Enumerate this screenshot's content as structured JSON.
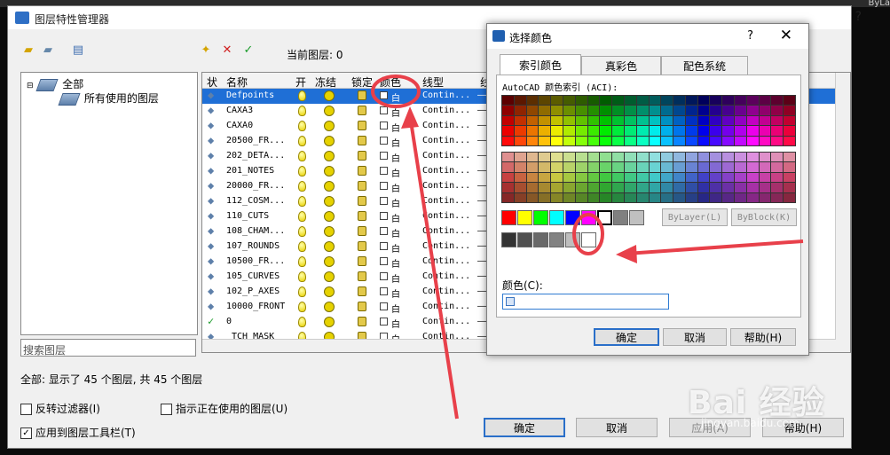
{
  "topbar": {
    "right_text": "ByLa"
  },
  "main_window": {
    "title": "图层特性管理器",
    "help_glyph": "?",
    "current_layer_label": "当前图层: 0",
    "tree": {
      "root": "全部",
      "child": "所有使用的图层"
    },
    "search_placeholder": "搜索图层",
    "columns": [
      "状",
      "名称",
      "开",
      "冻结",
      "锁定",
      "颜色",
      "线型",
      "线"
    ],
    "rows": [
      {
        "name": "Defpoints",
        "color": "白",
        "linetype": "Contin..."
      },
      {
        "name": "CAXA3",
        "color": "白",
        "linetype": "Contin..."
      },
      {
        "name": "CAXA0",
        "color": "白",
        "linetype": "Contin..."
      },
      {
        "name": "20500_FR...",
        "color": "白",
        "linetype": "Contin..."
      },
      {
        "name": "202_DETA...",
        "color": "白",
        "linetype": "Contin..."
      },
      {
        "name": "201_NOTES",
        "color": "白",
        "linetype": "Contin..."
      },
      {
        "name": "20000_FR...",
        "color": "白",
        "linetype": "Contin..."
      },
      {
        "name": "112_COSM...",
        "color": "白",
        "linetype": "Contin..."
      },
      {
        "name": "110_CUTS",
        "color": "白",
        "linetype": "Contin..."
      },
      {
        "name": "108_CHAM...",
        "color": "白",
        "linetype": "Contin..."
      },
      {
        "name": "107_ROUNDS",
        "color": "白",
        "linetype": "Contin..."
      },
      {
        "name": "10500_FR...",
        "color": "白",
        "linetype": "Contin..."
      },
      {
        "name": "105_CURVES",
        "color": "白",
        "linetype": "Contin..."
      },
      {
        "name": "102_P_AXES",
        "color": "白",
        "linetype": "Contin..."
      },
      {
        "name": "10000_FRONT",
        "color": "白",
        "linetype": "Contin..."
      },
      {
        "name": "0",
        "color": "白",
        "linetype": "Contin..."
      },
      {
        "name": "_TCH_MASK",
        "color": "白",
        "linetype": "Contin..."
      }
    ],
    "summary": "全部: 显示了 45 个图层, 共 45 个图层",
    "checkbox_invert": "反转过滤器(I)",
    "checkbox_show_used": "指示正在使用的图层(U)",
    "checkbox_apply": "应用到图层工具栏(T)",
    "btn_ok": "确定",
    "btn_cancel": "取消",
    "btn_apply": "应用(A)",
    "btn_help": "帮助(H)"
  },
  "color_dialog": {
    "title": "选择颜色",
    "help_glyph": "?",
    "close_glyph": "✕",
    "tabs": [
      "索引颜色",
      "真彩色",
      "配色系统"
    ],
    "aci_label": "AutoCAD 颜色索引 (ACI):",
    "bylayer": "ByLayer(L)",
    "byblock": "ByBlock(K)",
    "color_label": "颜色(C):",
    "btn_ok": "确定",
    "btn_cancel": "取消",
    "btn_help": "帮助(H)",
    "std_colors": [
      "#ff0000",
      "#ffff00",
      "#00ff00",
      "#00ffff",
      "#0000ff",
      "#ff00ff",
      "#ffffff",
      "#808080",
      "#c0c0c0"
    ],
    "gray_colors": [
      "#333333",
      "#505050",
      "#696969",
      "#828282",
      "#bebebe",
      "#ffffff"
    ],
    "highlight_color": "#e8404a"
  },
  "watermark": {
    "text": "Bai  经验",
    "url": "jingyan.baidu.com"
  }
}
